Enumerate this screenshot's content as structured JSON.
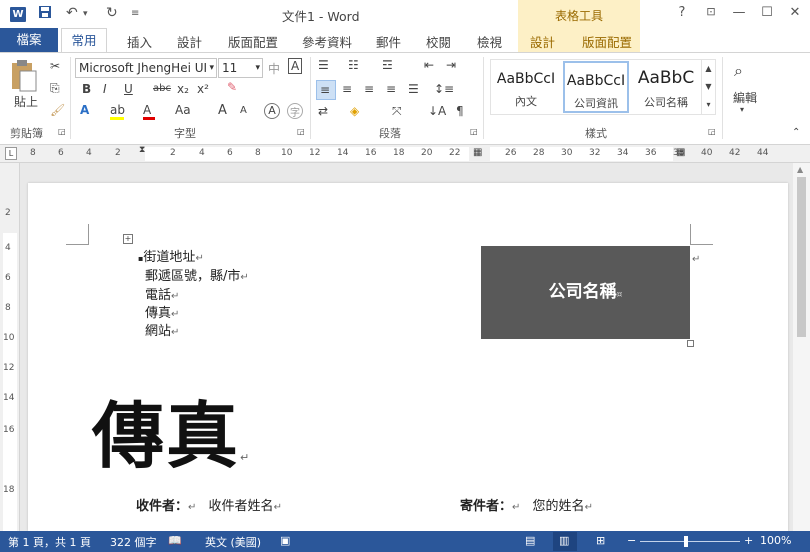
{
  "titlebar": {
    "app_logo": "W",
    "save_icon": "save-icon",
    "undo_icon": "undo-icon",
    "redo_icon": "redo-icon",
    "customize_icon": "customize-icon",
    "doc_title": "文件1 - Word",
    "context_group": "表格工具",
    "help": "?",
    "controls": [
      "help",
      "ribbon-display",
      "minimize",
      "maximize",
      "close"
    ]
  },
  "tabs": {
    "file": "檔案",
    "active": "常用",
    "items": [
      "插入",
      "設計",
      "版面配置",
      "參考資料",
      "郵件",
      "校閱",
      "檢視",
      "設計",
      "版面配置"
    ]
  },
  "ribbon": {
    "clipboard": {
      "paste": "貼上",
      "label": "剪貼簿"
    },
    "font": {
      "name": "Microsoft JhengHei UI",
      "size": "11",
      "label": "字型",
      "bold": "B",
      "italic": "I",
      "underline": "U",
      "strike": "abc",
      "sub": "x₂",
      "sup": "x²",
      "grow": "A",
      "shrink": "A",
      "case": "Aa",
      "phonetic": "中",
      "border_char": "A",
      "enclose": "字"
    },
    "paragraph": {
      "label": "段落"
    },
    "styles": {
      "label": "樣式",
      "items": [
        {
          "sample": "AaBbCcI",
          "name": "內文"
        },
        {
          "sample": "AaBbCcI",
          "name": "公司資訊"
        },
        {
          "sample": "AaBbC",
          "name": "公司名稱"
        }
      ]
    },
    "editing": {
      "label": "編輯"
    }
  },
  "ruler": {
    "numbers": [
      "8",
      "6",
      "4",
      "2",
      "2",
      "4",
      "6",
      "8",
      "10",
      "12",
      "14",
      "16",
      "18",
      "20",
      "22",
      "26",
      "28",
      "30",
      "32",
      "34",
      "36",
      "38",
      "40",
      "42",
      "44"
    ]
  },
  "vruler": {
    "numbers": [
      "2",
      "4",
      "6",
      "8",
      "10",
      "12",
      "14",
      "16",
      "18"
    ]
  },
  "document": {
    "address": [
      "街道地址",
      "郵遞區號，縣/市",
      "電話",
      "傳真",
      "網站"
    ],
    "company": "公司名稱",
    "title": "傳真",
    "to_label": "收件者：",
    "to_value": "收件者姓名",
    "from_label": "寄件者：",
    "from_value": "您的姓名"
  },
  "status": {
    "page": "第 1 頁，共 1 頁",
    "words": "322 個字",
    "lang": "英文 (美國)",
    "zoom": "100%"
  },
  "colors": {
    "accent": "#2b579a",
    "company_box": "#595959",
    "context_band": "#fdf0c6"
  }
}
